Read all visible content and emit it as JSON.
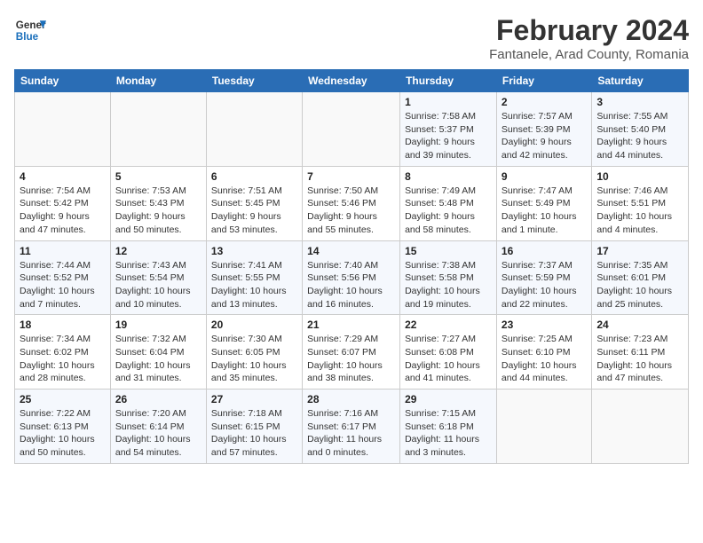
{
  "header": {
    "logo_line1": "General",
    "logo_line2": "Blue",
    "title": "February 2024",
    "subtitle": "Fantanele, Arad County, Romania"
  },
  "weekdays": [
    "Sunday",
    "Monday",
    "Tuesday",
    "Wednesday",
    "Thursday",
    "Friday",
    "Saturday"
  ],
  "weeks": [
    [
      {
        "day": "",
        "info": ""
      },
      {
        "day": "",
        "info": ""
      },
      {
        "day": "",
        "info": ""
      },
      {
        "day": "",
        "info": ""
      },
      {
        "day": "1",
        "info": "Sunrise: 7:58 AM\nSunset: 5:37 PM\nDaylight: 9 hours\nand 39 minutes."
      },
      {
        "day": "2",
        "info": "Sunrise: 7:57 AM\nSunset: 5:39 PM\nDaylight: 9 hours\nand 42 minutes."
      },
      {
        "day": "3",
        "info": "Sunrise: 7:55 AM\nSunset: 5:40 PM\nDaylight: 9 hours\nand 44 minutes."
      }
    ],
    [
      {
        "day": "4",
        "info": "Sunrise: 7:54 AM\nSunset: 5:42 PM\nDaylight: 9 hours\nand 47 minutes."
      },
      {
        "day": "5",
        "info": "Sunrise: 7:53 AM\nSunset: 5:43 PM\nDaylight: 9 hours\nand 50 minutes."
      },
      {
        "day": "6",
        "info": "Sunrise: 7:51 AM\nSunset: 5:45 PM\nDaylight: 9 hours\nand 53 minutes."
      },
      {
        "day": "7",
        "info": "Sunrise: 7:50 AM\nSunset: 5:46 PM\nDaylight: 9 hours\nand 55 minutes."
      },
      {
        "day": "8",
        "info": "Sunrise: 7:49 AM\nSunset: 5:48 PM\nDaylight: 9 hours\nand 58 minutes."
      },
      {
        "day": "9",
        "info": "Sunrise: 7:47 AM\nSunset: 5:49 PM\nDaylight: 10 hours\nand 1 minute."
      },
      {
        "day": "10",
        "info": "Sunrise: 7:46 AM\nSunset: 5:51 PM\nDaylight: 10 hours\nand 4 minutes."
      }
    ],
    [
      {
        "day": "11",
        "info": "Sunrise: 7:44 AM\nSunset: 5:52 PM\nDaylight: 10 hours\nand 7 minutes."
      },
      {
        "day": "12",
        "info": "Sunrise: 7:43 AM\nSunset: 5:54 PM\nDaylight: 10 hours\nand 10 minutes."
      },
      {
        "day": "13",
        "info": "Sunrise: 7:41 AM\nSunset: 5:55 PM\nDaylight: 10 hours\nand 13 minutes."
      },
      {
        "day": "14",
        "info": "Sunrise: 7:40 AM\nSunset: 5:56 PM\nDaylight: 10 hours\nand 16 minutes."
      },
      {
        "day": "15",
        "info": "Sunrise: 7:38 AM\nSunset: 5:58 PM\nDaylight: 10 hours\nand 19 minutes."
      },
      {
        "day": "16",
        "info": "Sunrise: 7:37 AM\nSunset: 5:59 PM\nDaylight: 10 hours\nand 22 minutes."
      },
      {
        "day": "17",
        "info": "Sunrise: 7:35 AM\nSunset: 6:01 PM\nDaylight: 10 hours\nand 25 minutes."
      }
    ],
    [
      {
        "day": "18",
        "info": "Sunrise: 7:34 AM\nSunset: 6:02 PM\nDaylight: 10 hours\nand 28 minutes."
      },
      {
        "day": "19",
        "info": "Sunrise: 7:32 AM\nSunset: 6:04 PM\nDaylight: 10 hours\nand 31 minutes."
      },
      {
        "day": "20",
        "info": "Sunrise: 7:30 AM\nSunset: 6:05 PM\nDaylight: 10 hours\nand 35 minutes."
      },
      {
        "day": "21",
        "info": "Sunrise: 7:29 AM\nSunset: 6:07 PM\nDaylight: 10 hours\nand 38 minutes."
      },
      {
        "day": "22",
        "info": "Sunrise: 7:27 AM\nSunset: 6:08 PM\nDaylight: 10 hours\nand 41 minutes."
      },
      {
        "day": "23",
        "info": "Sunrise: 7:25 AM\nSunset: 6:10 PM\nDaylight: 10 hours\nand 44 minutes."
      },
      {
        "day": "24",
        "info": "Sunrise: 7:23 AM\nSunset: 6:11 PM\nDaylight: 10 hours\nand 47 minutes."
      }
    ],
    [
      {
        "day": "25",
        "info": "Sunrise: 7:22 AM\nSunset: 6:13 PM\nDaylight: 10 hours\nand 50 minutes."
      },
      {
        "day": "26",
        "info": "Sunrise: 7:20 AM\nSunset: 6:14 PM\nDaylight: 10 hours\nand 54 minutes."
      },
      {
        "day": "27",
        "info": "Sunrise: 7:18 AM\nSunset: 6:15 PM\nDaylight: 10 hours\nand 57 minutes."
      },
      {
        "day": "28",
        "info": "Sunrise: 7:16 AM\nSunset: 6:17 PM\nDaylight: 11 hours\nand 0 minutes."
      },
      {
        "day": "29",
        "info": "Sunrise: 7:15 AM\nSunset: 6:18 PM\nDaylight: 11 hours\nand 3 minutes."
      },
      {
        "day": "",
        "info": ""
      },
      {
        "day": "",
        "info": ""
      }
    ]
  ]
}
